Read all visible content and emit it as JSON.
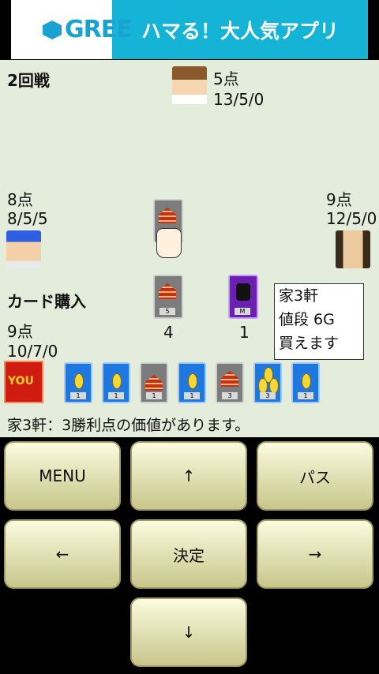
{
  "banner": {
    "logo_text": "GREE",
    "ad_text": "ハマる！大人気アプリ"
  },
  "game": {
    "round": "2回戦",
    "top_player": {
      "points": "5点",
      "stats": "13/5/0"
    },
    "left_player": {
      "points": "8点",
      "stats": "8/5/5"
    },
    "right_player": {
      "points": "9点",
      "stats": "12/5/0"
    },
    "me": {
      "points": "9点",
      "stats": "10/7/0",
      "badge": "YOU"
    },
    "phase": "カード購入",
    "supply": [
      {
        "name": "house",
        "count": "4"
      },
      {
        "name": "monster",
        "count": "1"
      }
    ],
    "info_box": {
      "line1": "家3軒",
      "line2": "値段 6G",
      "line3": "買えます"
    },
    "hand_cards": [
      {
        "type": "coin",
        "value": "1"
      },
      {
        "type": "coin",
        "value": "1"
      },
      {
        "type": "house",
        "value": "1"
      },
      {
        "type": "coin",
        "value": "1"
      },
      {
        "type": "house",
        "value": "3"
      },
      {
        "type": "coin3",
        "value": "3"
      },
      {
        "type": "coin",
        "value": "1"
      }
    ],
    "message": "家3軒：3勝利点の価値があります。"
  },
  "controls": {
    "menu": "MENU",
    "up": "↑",
    "pass": "パス",
    "left": "←",
    "confirm": "決定",
    "right": "→",
    "down": "↓"
  },
  "colors": {
    "board": "#e4ecdc",
    "button_top": "#fbfbe0",
    "button_bottom": "#c9c68a",
    "banner": "#15b3d6"
  }
}
